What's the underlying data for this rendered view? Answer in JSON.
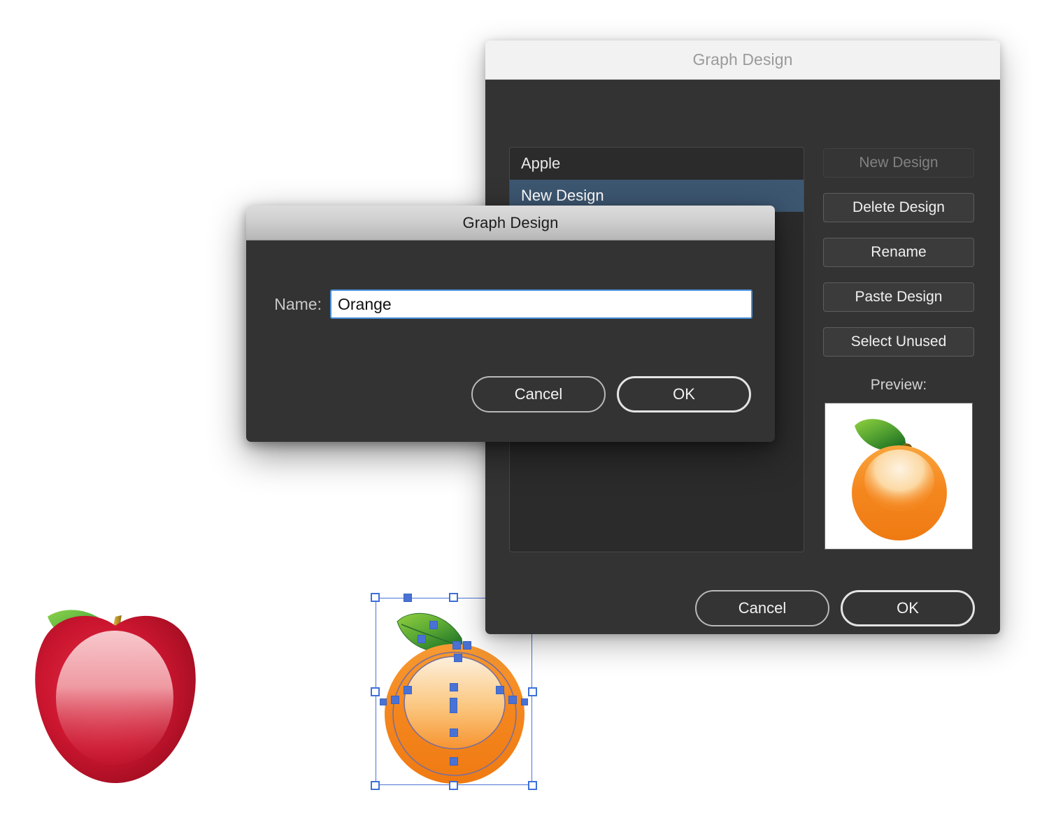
{
  "canvas": {
    "artwork": [
      {
        "name": "apple",
        "label": "Apple graph design artwork",
        "selected": false
      },
      {
        "name": "orange",
        "label": "Orange graph design artwork",
        "selected": true
      }
    ],
    "colors": {
      "background": "#ffffff",
      "apple_red": "#c8102e",
      "apple_red_light": "#e8495c",
      "apple_highlight": "#f4b9bd",
      "leaf_green_light": "#7ac943",
      "leaf_green_dark": "#1f7a34",
      "stem_tan": "#c9a227",
      "orange_fill": "#f58220",
      "orange_highlight": "#fde8c8",
      "selection_blue": "#4a72d4"
    }
  },
  "back_dialog": {
    "title": "Graph Design",
    "active": false,
    "list": {
      "items": [
        {
          "label": "Apple",
          "selected": false
        },
        {
          "label": "New Design",
          "selected": true
        }
      ]
    },
    "side_buttons": [
      {
        "label": "New Design",
        "enabled": false
      },
      {
        "label": "Delete Design",
        "enabled": true
      },
      {
        "label": "Rename",
        "enabled": true
      },
      {
        "label": "Paste Design",
        "enabled": true
      },
      {
        "label": "Select Unused",
        "enabled": true
      }
    ],
    "preview_label": "Preview:",
    "preview_artwork": "orange",
    "footer": {
      "cancel_label": "Cancel",
      "ok_label": "OK"
    }
  },
  "front_dialog": {
    "title": "Graph Design",
    "active": true,
    "name_label": "Name:",
    "name_value": "Orange",
    "name_placeholder": "Name",
    "footer": {
      "cancel_label": "Cancel",
      "ok_label": "OK"
    }
  }
}
